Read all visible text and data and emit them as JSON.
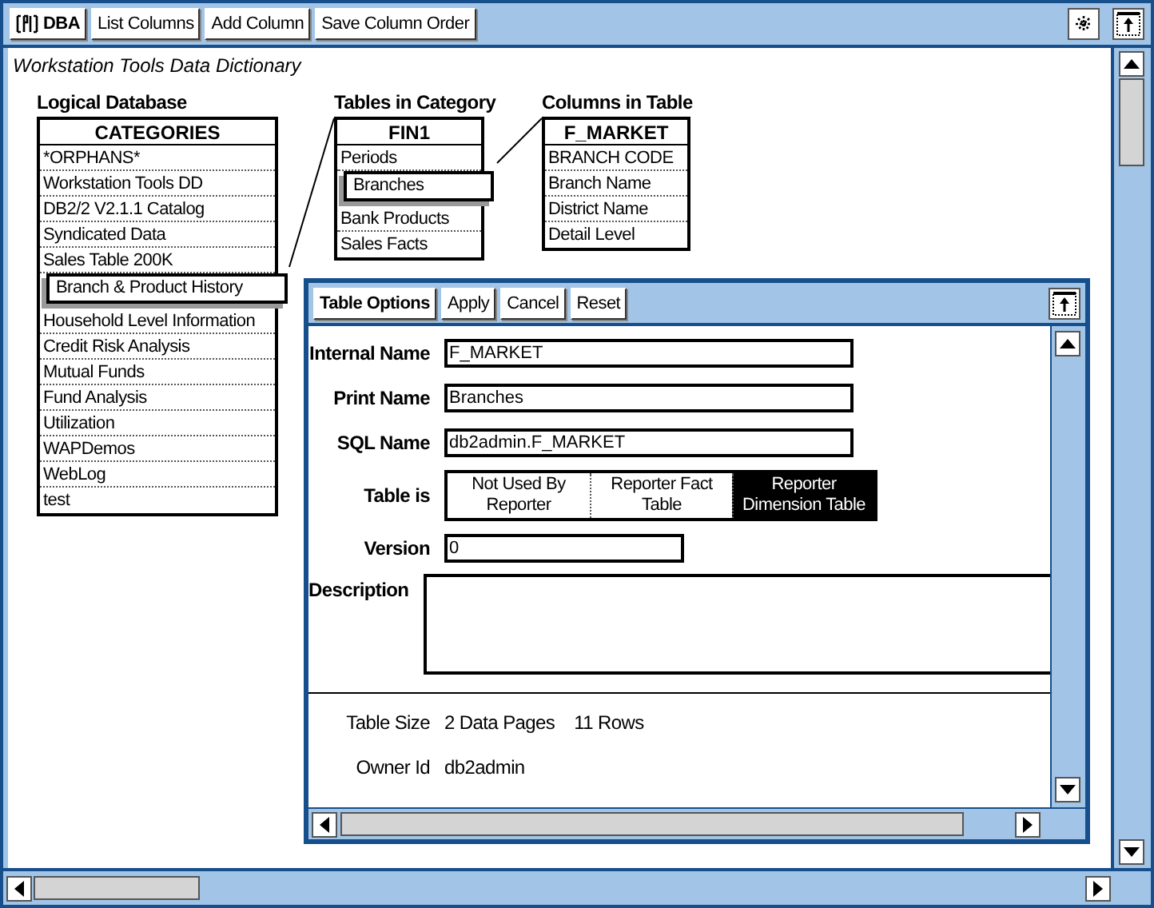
{
  "toolbar": {
    "buttons": [
      {
        "label": "DBA",
        "kind": "app"
      },
      {
        "label": "List Columns",
        "kind": "plain"
      },
      {
        "label": "Add Column",
        "kind": "plain"
      },
      {
        "label": "Save Column Order",
        "kind": "plain"
      }
    ]
  },
  "subtitle": "Workstation Tools Data Dictionary",
  "categories": {
    "heading": "Logical Database",
    "title": "CATEGORIES",
    "items": [
      {
        "label": "*ORPHANS*",
        "selected": false
      },
      {
        "label": "Workstation Tools DD",
        "selected": false
      },
      {
        "label": "DB2/2 V2.1.1 Catalog",
        "selected": false
      },
      {
        "label": "Syndicated Data",
        "selected": false
      },
      {
        "label": "Sales Table 200K",
        "selected": false
      },
      {
        "label": "Branch & Product History",
        "selected": true
      },
      {
        "label": "Household Level Information",
        "selected": false
      },
      {
        "label": "Credit Risk Analysis",
        "selected": false
      },
      {
        "label": "Mutual Funds",
        "selected": false
      },
      {
        "label": "Fund Analysis",
        "selected": false
      },
      {
        "label": "Utilization",
        "selected": false
      },
      {
        "label": "WAPDemos",
        "selected": false
      },
      {
        "label": "WebLog",
        "selected": false
      },
      {
        "label": "test",
        "selected": false
      }
    ]
  },
  "tables": {
    "heading": "Tables in Category",
    "title": "FIN1",
    "items": [
      {
        "label": "Periods",
        "selected": false
      },
      {
        "label": "Branches",
        "selected": true
      },
      {
        "label": "Bank Products",
        "selected": false
      },
      {
        "label": "Sales Facts",
        "selected": false
      }
    ]
  },
  "columns": {
    "heading": "Columns in Table",
    "title": "F_MARKET",
    "items": [
      {
        "label": "BRANCH CODE"
      },
      {
        "label": "Branch Name"
      },
      {
        "label": "District Name"
      },
      {
        "label": "Detail Level"
      }
    ]
  },
  "table_options": {
    "buttons": [
      {
        "label": "Table Options",
        "kind": "title"
      },
      {
        "label": "Apply",
        "kind": "plain"
      },
      {
        "label": "Cancel",
        "kind": "plain"
      },
      {
        "label": "Reset",
        "kind": "plain"
      }
    ],
    "internal_name": {
      "label": "Internal Name",
      "value": "F_MARKET"
    },
    "print_name": {
      "label": "Print Name",
      "value": "Branches"
    },
    "sql_name": {
      "label": "SQL Name",
      "value": "db2admin.F_MARKET"
    },
    "table_is": {
      "label": "Table is",
      "options": [
        {
          "label": "Not Used By Reporter",
          "selected": false
        },
        {
          "label": "Reporter Fact Table",
          "selected": false
        },
        {
          "label": "Reporter Dimension Table",
          "selected": true
        }
      ]
    },
    "version": {
      "label": "Version",
      "value": "0"
    },
    "description": {
      "label": "Description"
    },
    "table_size": {
      "label": "Table Size",
      "values": [
        "2 Data Pages",
        "11 Rows"
      ]
    },
    "owner_id": {
      "label": "Owner Id",
      "value": "db2admin"
    }
  }
}
